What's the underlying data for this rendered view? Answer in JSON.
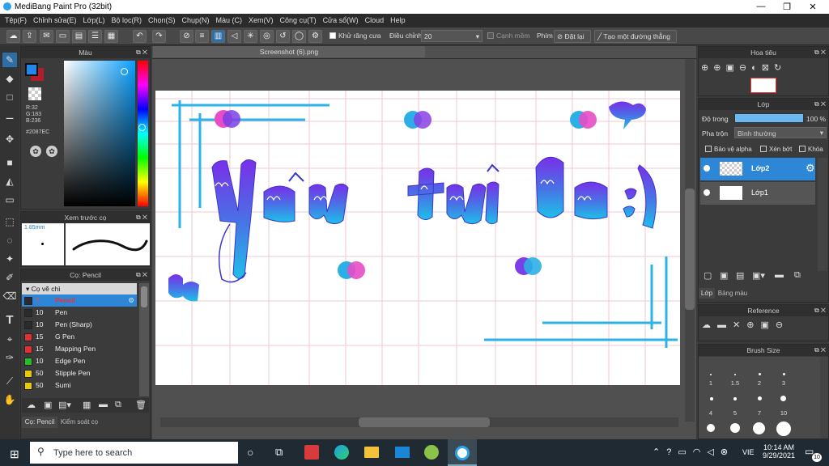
{
  "app": {
    "title": "MediBang Paint Pro (32bit)"
  },
  "menu": [
    "Tệp(F)",
    "Chỉnh sửa(E)",
    "Lớp(L)",
    "Bộ lọc(R)",
    "Chọn(S)",
    "Chụp(N)",
    "Màu (C)",
    "Xem(V)",
    "Công cụ(T)",
    "Cửa sổ(W)",
    "Cloud",
    "Help"
  ],
  "toolbar": {
    "antialias": "Khử răng cưa",
    "adjust": "Điều chỉnh",
    "adjust_value": "20",
    "smooth": "Cạnh mềm",
    "key_label": "Phím",
    "reset": "Đặt lại",
    "new_line": "Tạo một đường thẳng"
  },
  "color_panel": {
    "title": "Màu",
    "r": "R:32",
    "g": "G:183",
    "b": "B:236",
    "hex": "#2087EC",
    "primary": "#2087EC",
    "secondary": "#B01E2A"
  },
  "preview_panel": {
    "title": "Xem trước cọ",
    "size": "1.85mm"
  },
  "brush_panel": {
    "title": "Cọ: Pencil",
    "group": "Cọ vẽ chì",
    "items": [
      {
        "size": "7",
        "name": "Pencil",
        "color": "#2b2b2b"
      },
      {
        "size": "10",
        "name": "Pen",
        "color": "#2b2b2b"
      },
      {
        "size": "10",
        "name": "Pen (Sharp)",
        "color": "#2b2b2b"
      },
      {
        "size": "15",
        "name": "G Pen",
        "color": "#e03030"
      },
      {
        "size": "15",
        "name": "Mapping Pen",
        "color": "#e03030"
      },
      {
        "size": "10",
        "name": "Edge Pen",
        "color": "#22c022"
      },
      {
        "size": "50",
        "name": "Stipple Pen",
        "color": "#e8c800"
      },
      {
        "size": "50",
        "name": "Sumi",
        "color": "#e8c800"
      }
    ],
    "tab1": "Cọ: Pencil",
    "tab2": "Kiểm soát cọ"
  },
  "document": {
    "tab": "Screenshot (6).png"
  },
  "navigator": {
    "title": "Hoa tiêu"
  },
  "layer_panel": {
    "title": "Lớp",
    "opacity_label": "Độ trong",
    "opacity_value": "100 %",
    "blend_label": "Pha trộn",
    "blend_value": "Bình thường",
    "protect_alpha": "Bảo vệ alpha",
    "clipping": "Xén bớt",
    "lock": "Khóa",
    "layers": [
      "Lớp2",
      "Lớp1"
    ],
    "tab1": "Lớp",
    "tab2": "Bảng màu"
  },
  "reference_panel": {
    "title": "Reference"
  },
  "brushsize_panel": {
    "title": "Brush Size",
    "sizes": [
      "1",
      "1.5",
      "2",
      "3",
      "4",
      "5",
      "7",
      "10"
    ]
  },
  "taskbar": {
    "search_placeholder": "Type here to search",
    "lang": "VIE",
    "time": "10:14 AM",
    "date": "9/29/2021",
    "notif": "10"
  }
}
